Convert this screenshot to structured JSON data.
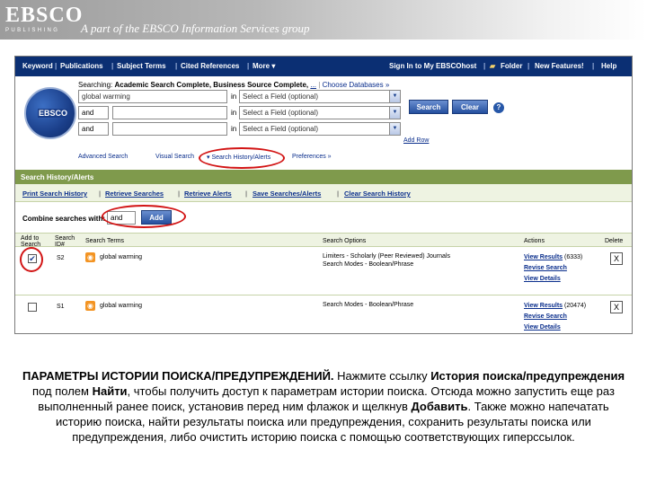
{
  "branding": {
    "logo_word": "EBSCO",
    "logo_sub": "PUBLISHING",
    "tagline": "A part of the EBSCO Information Services group"
  },
  "topnav": {
    "left": [
      "Keyword",
      "Publications",
      "Subject Terms",
      "Cited References",
      "More ▾"
    ],
    "right": [
      "Sign In to My EBSCOhost",
      "Folder",
      "New Features!",
      "Help"
    ]
  },
  "search": {
    "searching_prefix": "Searching:",
    "databases": "Academic Search Complete, Business Source Complete,",
    "databases_more": "...",
    "choose_db": "Choose Databases »",
    "badge": "EBSCO",
    "rows": [
      {
        "bool": "",
        "term": "global warming",
        "in": "in",
        "field": "Select a Field (optional)"
      },
      {
        "bool": "and",
        "term": "",
        "in": "in",
        "field": "Select a Field (optional)"
      },
      {
        "bool": "and",
        "term": "",
        "in": "in",
        "field": "Select a Field (optional)"
      }
    ],
    "search_btn": "Search",
    "clear_btn": "Clear",
    "help": "?",
    "add_row": "Add Row",
    "subnav": [
      "Advanced Search",
      "Visual Search",
      "▾ Search History/Alerts",
      "Preferences »"
    ]
  },
  "history": {
    "bar_title": "Search History/Alerts",
    "links": [
      "Print Search History",
      "Retrieve Searches",
      "Retrieve Alerts",
      "Save Searches/Alerts",
      "Clear Search History"
    ],
    "combine_label": "Combine searches with:",
    "combine_value": "and",
    "add_btn": "Add",
    "columns": {
      "select": "Add to Search",
      "id": "Search ID#",
      "terms": "Search Terms",
      "options": "Search Options",
      "actions": "Actions",
      "delete": "Delete"
    },
    "rows": [
      {
        "checked": "✔",
        "id": "S2",
        "terms": "global warming",
        "options_1": "Limiters - Scholarly (Peer Reviewed) Journals",
        "options_2": "Search Modes - Boolean/Phrase",
        "view_results": "View Results",
        "count": "(6333)",
        "revise": "Revise Search",
        "details": "View Details",
        "delete": "X"
      },
      {
        "checked": "",
        "id": "S1",
        "terms": "global warming",
        "options_1": "Search Modes - Boolean/Phrase",
        "options_2": "",
        "view_results": "View Results",
        "count": "(20474)",
        "revise": "Revise Search",
        "details": "View Details",
        "delete": "X"
      }
    ]
  },
  "caption": {
    "p1_bold": "ПАРАМЕТРЫ ИСТОРИИ ПОИСКА/ПРЕДУПРЕЖДЕНИЙ.",
    "p1": " Нажмите ссылку ",
    "p1_bold2": "История поиска/предупреждения",
    "p2": " под полем ",
    "p2_bold": "Найти",
    "p3": ", чтобы получить доступ к параметрам истории поиска. Отсюда можно запустить еще раз выполненный ранее поиск, установив перед ним флажок и щелкнув ",
    "p3_bold": "Добавить",
    "p4": ". Также можно напечатать историю поиска, найти результаты поиска или предупреждения, сохранить результаты поиска или предупреждения, либо очистить историю поиска с помощью соответствующих гиперссылок."
  },
  "colors": {
    "nav_bg": "#0b2f73",
    "history_bar": "#7f9a4c",
    "annotation": "#d21414",
    "link": "#0a2e8c"
  }
}
